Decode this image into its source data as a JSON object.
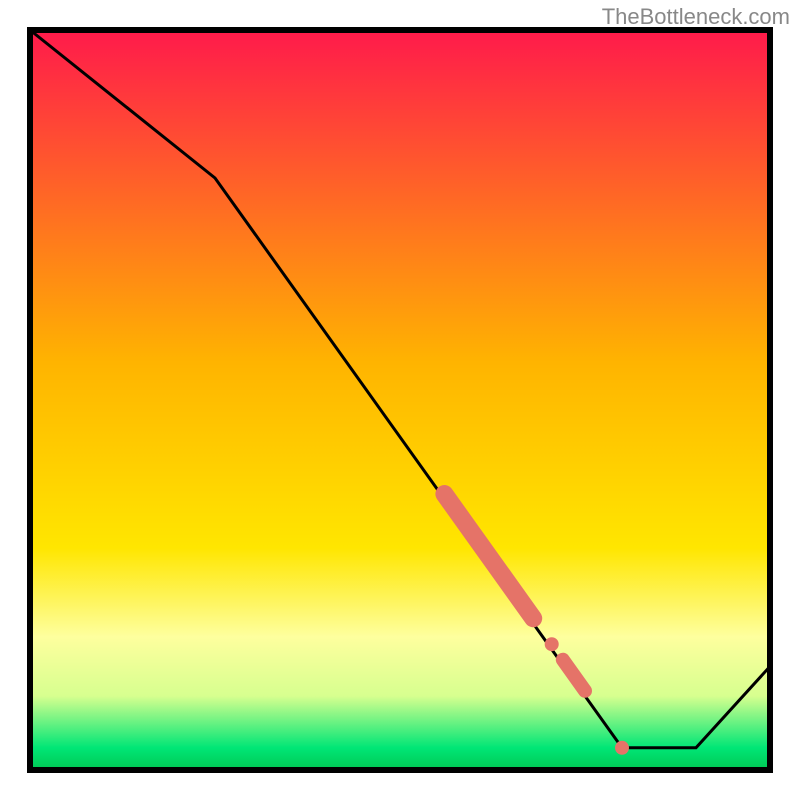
{
  "attribution": "TheBottleneck.com",
  "chart_data": {
    "type": "line",
    "title": "",
    "xlabel": "",
    "ylabel": "",
    "xlim": [
      0,
      100
    ],
    "ylim": [
      0,
      100
    ],
    "series": [
      {
        "name": "main-curve",
        "x": [
          0,
          25,
          80,
          90,
          100
        ],
        "values": [
          100,
          80,
          3,
          3,
          14
        ]
      }
    ],
    "highlights": [
      {
        "name": "segment-a",
        "x0": 56,
        "y0": 37.3,
        "x1": 68,
        "y1": 20.5,
        "weight": 9
      },
      {
        "name": "dot-a",
        "x0": 70.5,
        "y0": 17.0,
        "x1": 70.5,
        "y1": 17.0,
        "weight": 7
      },
      {
        "name": "segment-b",
        "x0": 72,
        "y0": 14.9,
        "x1": 75,
        "y1": 10.7,
        "weight": 7
      },
      {
        "name": "dot-b",
        "x0": 80,
        "y0": 3.0,
        "x1": 80,
        "y1": 3.0,
        "weight": 7
      }
    ],
    "gradient_stops": [
      {
        "offset": 0,
        "color": "#ff1a4b"
      },
      {
        "offset": 45,
        "color": "#ffb400"
      },
      {
        "offset": 70,
        "color": "#ffe600"
      },
      {
        "offset": 82,
        "color": "#feff9e"
      },
      {
        "offset": 90,
        "color": "#d7ff8f"
      },
      {
        "offset": 97,
        "color": "#00e676"
      },
      {
        "offset": 100,
        "color": "#00c853"
      }
    ]
  }
}
